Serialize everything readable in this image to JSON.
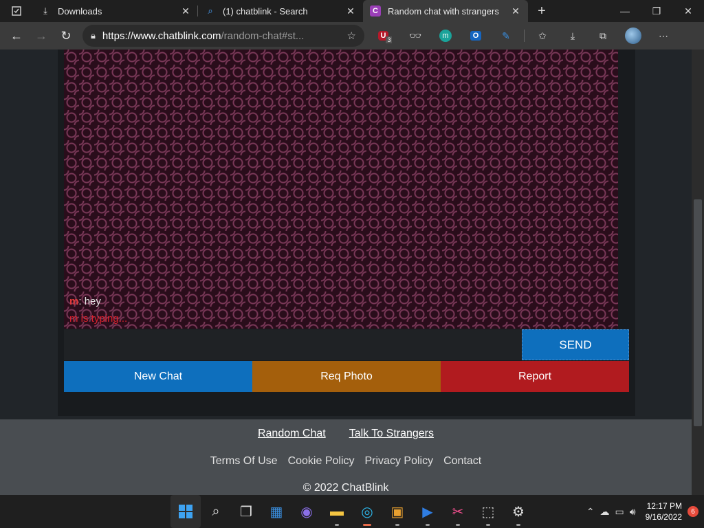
{
  "browser": {
    "tabs": [
      {
        "title": "Downloads",
        "icon": "download-icon"
      },
      {
        "title": "(1) chatblink - Search",
        "icon": "search-icon"
      },
      {
        "title": "Random chat with strangers",
        "icon": "chatblink-favicon"
      }
    ],
    "address": {
      "host": "https://www.chatblink.com",
      "path": "/random-chat#st..."
    },
    "extension_badge": "3"
  },
  "chat": {
    "messages": [
      {
        "nick": "m",
        "separator": ": ",
        "text": "hey"
      }
    ],
    "typing_status": "m is typing...",
    "input_value": "",
    "send_label": "SEND",
    "buttons": {
      "new_chat": "New Chat",
      "req_photo": "Req Photo",
      "report": "Report"
    }
  },
  "footer": {
    "links_primary": [
      "Random Chat",
      "Talk To Strangers"
    ],
    "links_secondary": [
      "Terms Of Use",
      "Cookie Policy",
      "Privacy Policy",
      "Contact"
    ],
    "copyright": "© 2022 ChatBlink"
  },
  "taskbar": {
    "time": "12:17 PM",
    "date": "9/16/2022",
    "notifications": "6"
  },
  "colors": {
    "accent_blue": "#0e6fbd",
    "photo_orange": "#a45f0c",
    "report_red": "#b11b1f",
    "typing_red": "#d9222e"
  }
}
